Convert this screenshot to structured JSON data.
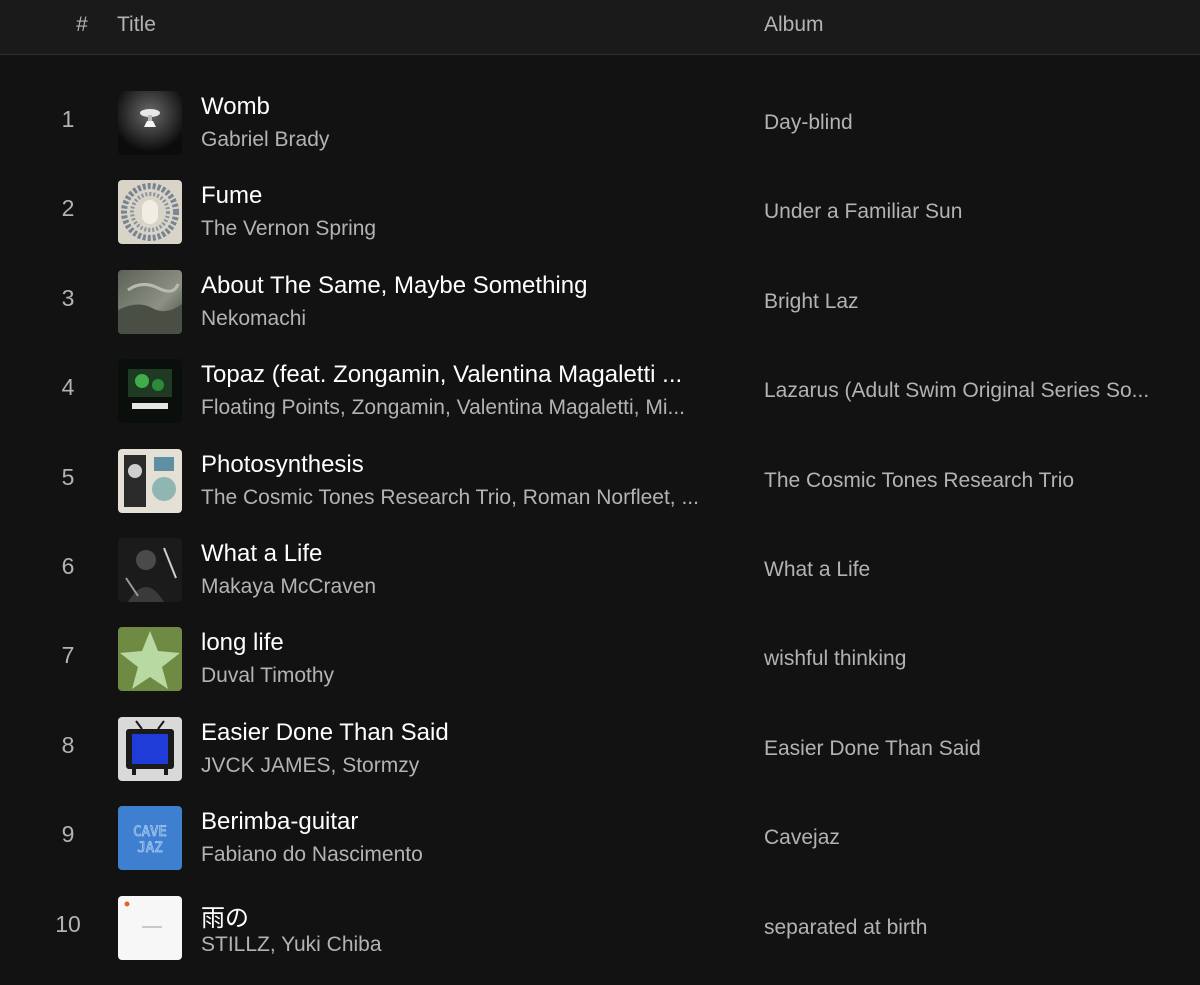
{
  "header": {
    "number_label": "#",
    "title_label": "Title",
    "album_label": "Album"
  },
  "tracks": [
    {
      "number": "1",
      "title": "Womb",
      "artist": "Gabriel Brady",
      "album": "Day-blind",
      "cover_icon": "cover-womb"
    },
    {
      "number": "2",
      "title": "Fume",
      "artist": "The Vernon Spring",
      "album": "Under a Familiar Sun",
      "cover_icon": "cover-fume"
    },
    {
      "number": "3",
      "title": "About The Same, Maybe Something",
      "artist": "Nekomachi",
      "album": "Bright Laz",
      "cover_icon": "cover-about-the-same"
    },
    {
      "number": "4",
      "title": "Topaz (feat. Zongamin, Valentina Magaletti ...",
      "artist": "Floating Points, Zongamin, Valentina Magaletti, Mi...",
      "album": "Lazarus (Adult Swim Original Series So...",
      "cover_icon": "cover-lazarus"
    },
    {
      "number": "5",
      "title": "Photosynthesis",
      "artist": "The Cosmic Tones Research Trio, Roman Norfleet, ...",
      "album": "The Cosmic Tones Research Trio",
      "cover_icon": "cover-photosynthesis"
    },
    {
      "number": "6",
      "title": "What a Life",
      "artist": "Makaya McCraven",
      "album": "What a Life",
      "cover_icon": "cover-what-a-life"
    },
    {
      "number": "7",
      "title": "long life",
      "artist": "Duval Timothy",
      "album": "wishful thinking",
      "cover_icon": "cover-long-life"
    },
    {
      "number": "8",
      "title": "Easier Done Than Said",
      "artist": "JVCK JAMES, Stormzy",
      "album": "Easier Done Than Said",
      "cover_icon": "cover-easier-done"
    },
    {
      "number": "9",
      "title": "Berimba-guitar",
      "artist": "Fabiano do Nascimento",
      "album": "Cavejaz",
      "cover_icon": "cover-cavejaz"
    },
    {
      "number": "10",
      "title": "雨の",
      "artist": "STILLZ, Yuki Chiba",
      "album": "separated at birth",
      "cover_icon": "cover-separated"
    }
  ],
  "colors": {
    "background": "#121212",
    "header_bg": "#1a1a1a",
    "primary_text": "#ffffff",
    "secondary_text": "#b3b3b3"
  }
}
